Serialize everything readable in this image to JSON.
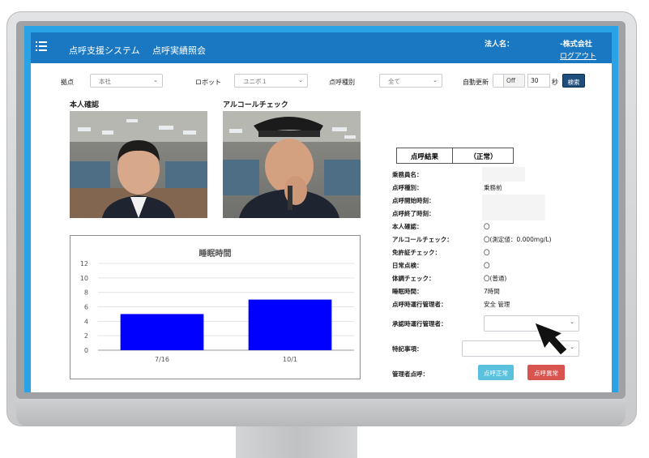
{
  "header": {
    "system_title": "点呼支援システム",
    "page_title": "点呼実績照会",
    "company_label": "法人名：",
    "company_value": "-株式会社",
    "logout": "ログアウト"
  },
  "filters": {
    "base_label": "拠点",
    "base_value": "本社",
    "robot_label": "ロボット",
    "robot_value": "ユニボ１",
    "type_label": "点呼種別",
    "type_value": "全て",
    "auto_update_label": "自動更新",
    "toggle_value": "Off",
    "interval_value": "30",
    "interval_unit": "秒",
    "search_button": "検索"
  },
  "photos": {
    "identity_title": "本人確認",
    "alcohol_title": "アルコールチェック"
  },
  "chart_data": {
    "type": "bar",
    "title": "睡眠時間",
    "categories": [
      "7/16",
      "10/1"
    ],
    "values": [
      5,
      7
    ],
    "ylim": [
      0,
      12
    ],
    "yticks": [
      "0",
      "2",
      "4",
      "6",
      "8",
      "10",
      "12"
    ],
    "grid": true,
    "bar_color": "#0000ff"
  },
  "result": {
    "header_label": "点呼結果",
    "header_status": "（正常）",
    "rows": [
      {
        "label": "乗務員名：",
        "value": ""
      },
      {
        "label": "点呼種別：",
        "value": "乗務前"
      },
      {
        "label": "点呼開始時刻：",
        "value": ""
      },
      {
        "label": "点呼終了時刻：",
        "value": ""
      },
      {
        "label": "本人確認：",
        "value": "〇"
      },
      {
        "label": "アルコールチェック：",
        "value": "〇(測定値：0.000mg/L)"
      },
      {
        "label": "免許証チェック：",
        "value": "〇"
      },
      {
        "label": "日常点検：",
        "value": "〇"
      },
      {
        "label": "体調チェック：",
        "value": "〇(普通)"
      },
      {
        "label": "睡眠時間：",
        "value": "7時間"
      },
      {
        "label": "点呼時運行管理者：",
        "value": "安全 管理"
      }
    ],
    "approver_label": "承認時運行管理者：",
    "remarks_label": "特記事項：",
    "manager_label": "管理者点呼：",
    "normal_button": "点呼正常",
    "abnormal_button": "点呼異常"
  }
}
